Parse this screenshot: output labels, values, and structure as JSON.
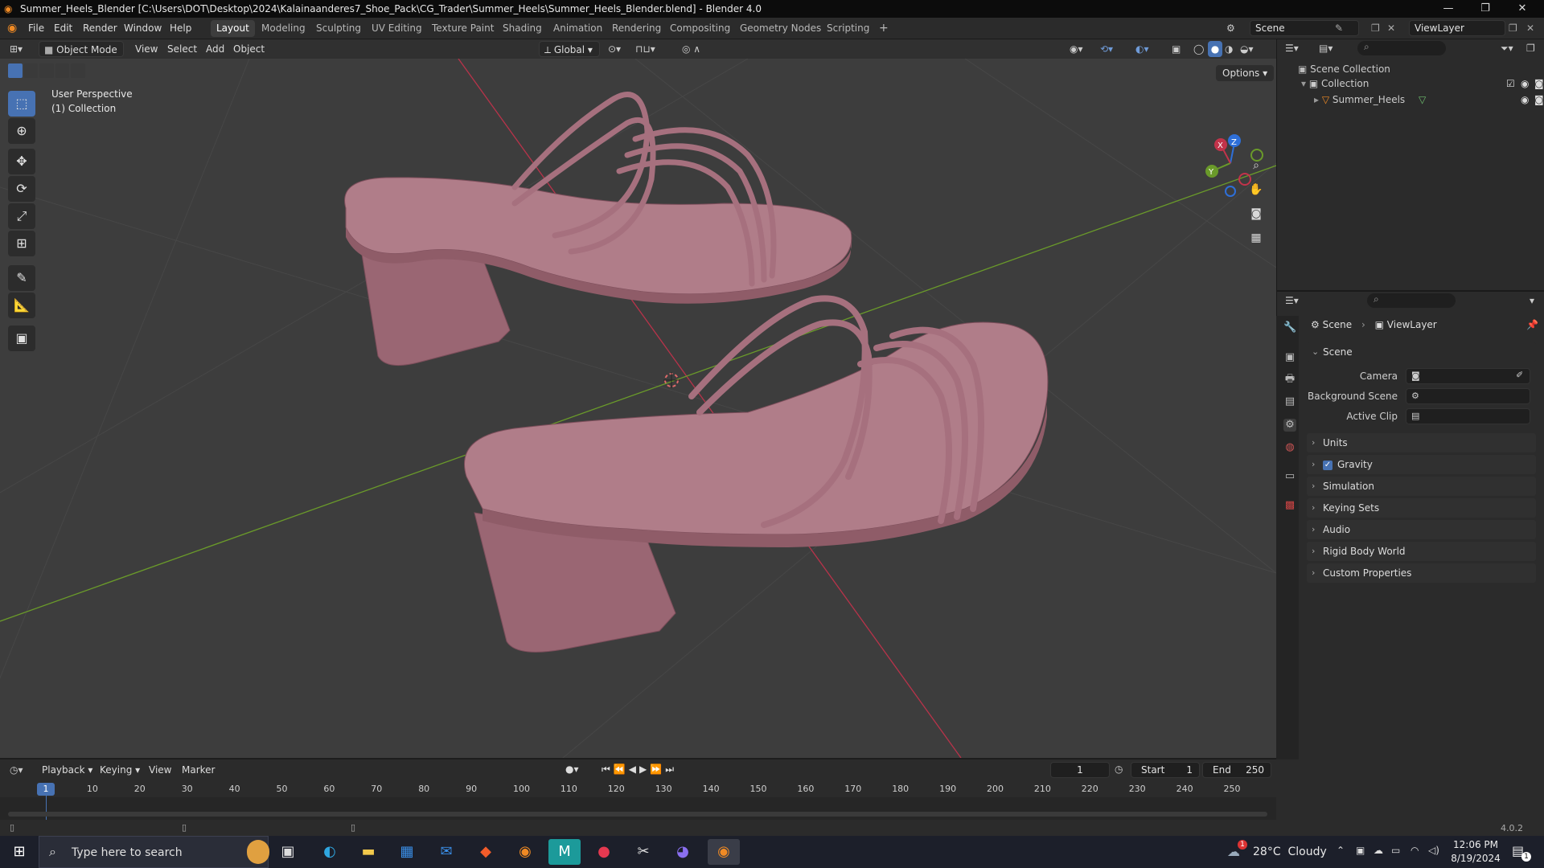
{
  "window": {
    "title": "Summer_Heels_Blender [C:\\Users\\DOT\\Desktop\\2024\\Kalainaanderes7_Shoe_Pack\\CG_Trader\\Summer_Heels\\Summer_Heels_Blender.blend] - Blender 4.0",
    "minimize": "—",
    "maximize": "❐",
    "close": "✕"
  },
  "menu": {
    "items": [
      "File",
      "Edit",
      "Render",
      "Window",
      "Help"
    ],
    "workspaces": [
      "Layout",
      "Modeling",
      "Sculpting",
      "UV Editing",
      "Texture Paint",
      "Shading",
      "Animation",
      "Rendering",
      "Compositing",
      "Geometry Nodes",
      "Scripting"
    ],
    "active_workspace": "Layout",
    "add_workspace": "+",
    "scene": "Scene",
    "view_layer": "ViewLayer"
  },
  "viewport_header": {
    "mode": "Object Mode",
    "menus": [
      "View",
      "Select",
      "Add",
      "Object"
    ],
    "transform_orientation": "Global",
    "options": "Options"
  },
  "viewport": {
    "perspective_label": "User Perspective",
    "collection_label": "(1) Collection",
    "gizmo": {
      "x": "X",
      "y": "Y",
      "z": "Z"
    }
  },
  "outliner": {
    "scene_collection": "Scene Collection",
    "collection": "Collection",
    "object": "Summer_Heels"
  },
  "properties": {
    "breadcrumb_scene": "Scene",
    "breadcrumb_viewlayer": "ViewLayer",
    "panel_title": "Scene",
    "fields": {
      "camera": "Camera",
      "background_scene": "Background Scene",
      "active_clip": "Active Clip"
    },
    "sections": [
      "Units",
      "Gravity",
      "Simulation",
      "Keying Sets",
      "Audio",
      "Rigid Body World",
      "Custom Properties"
    ],
    "gravity_checked": true
  },
  "timeline": {
    "menus": [
      "Playback",
      "Keying",
      "View",
      "Marker"
    ],
    "current_frame": "1",
    "start_label": "Start",
    "start": "1",
    "end_label": "End",
    "end": "250",
    "ticks": [
      "10",
      "20",
      "30",
      "40",
      "50",
      "60",
      "70",
      "80",
      "90",
      "100",
      "110",
      "120",
      "130",
      "140",
      "150",
      "160",
      "170",
      "180",
      "190",
      "200",
      "210",
      "220",
      "230",
      "240",
      "250"
    ],
    "playhead": "1"
  },
  "status": {
    "version": "4.0.2"
  },
  "taskbar": {
    "search_placeholder": "Type here to search",
    "weather": "28°C  Cloudy",
    "time": "12:06 PM",
    "date": "8/19/2024",
    "weather_badge": "1",
    "notification_count": "1"
  },
  "colors": {
    "accent": "#4772b3",
    "shoe": "#a8707e",
    "x_axis": "#c2334a",
    "y_axis": "#6a9a2a",
    "viewport_bg": "#3d3d3d"
  }
}
